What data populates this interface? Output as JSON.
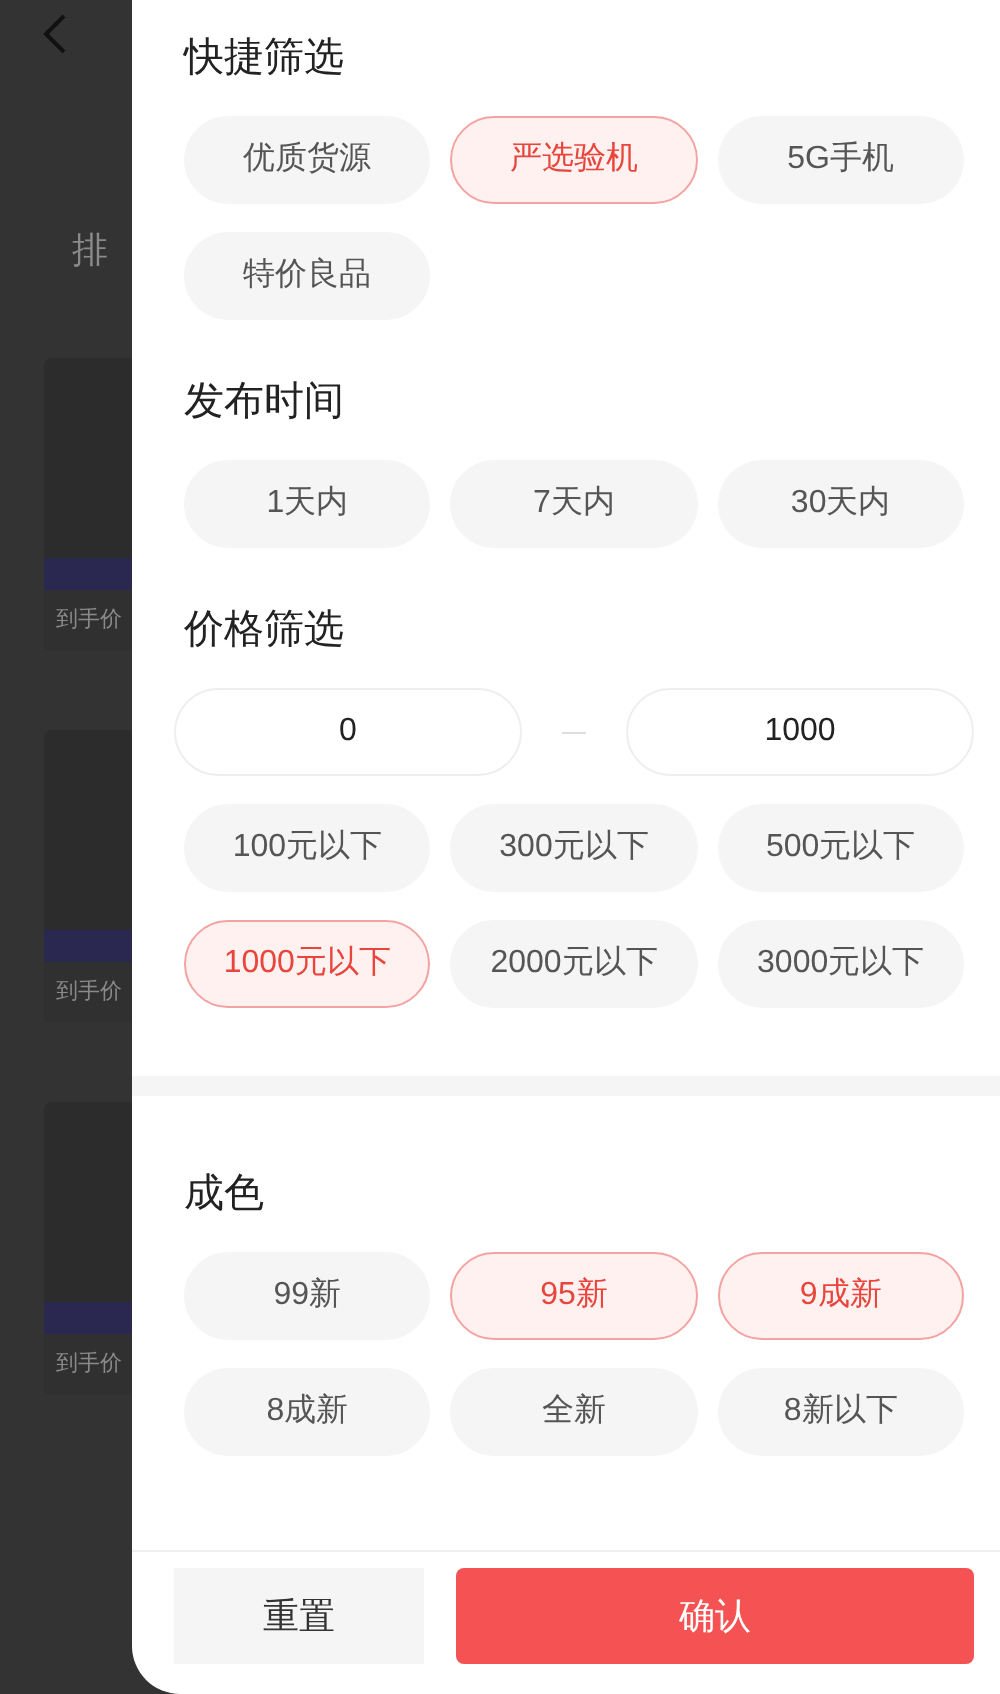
{
  "background": {
    "sort_label": "排",
    "price_labels": [
      "到手价",
      "到手价",
      "到手价"
    ]
  },
  "sections": [
    {
      "title": "快捷筛选",
      "options": [
        {
          "label": "优质货源",
          "selected": false
        },
        {
          "label": "严选验机",
          "selected": true
        },
        {
          "label": "5G手机",
          "selected": false
        },
        {
          "label": "特价良品",
          "selected": false
        }
      ]
    },
    {
      "title": "发布时间",
      "options": [
        {
          "label": "1天内",
          "selected": false
        },
        {
          "label": "7天内",
          "selected": false
        },
        {
          "label": "30天内",
          "selected": false
        }
      ]
    },
    {
      "title": "价格筛选",
      "price_min": "0",
      "price_max": "1000",
      "options": [
        {
          "label": "100元以下",
          "selected": false
        },
        {
          "label": "300元以下",
          "selected": false
        },
        {
          "label": "500元以下",
          "selected": false
        },
        {
          "label": "1000元以下",
          "selected": true
        },
        {
          "label": "2000元以下",
          "selected": false
        },
        {
          "label": "3000元以下",
          "selected": false
        }
      ]
    },
    {
      "title": "成色",
      "options": [
        {
          "label": "99新",
          "selected": false
        },
        {
          "label": "95新",
          "selected": true
        },
        {
          "label": "9成新",
          "selected": true
        },
        {
          "label": "8成新",
          "selected": false
        },
        {
          "label": "全新",
          "selected": false
        },
        {
          "label": "8新以下",
          "selected": false
        }
      ]
    }
  ],
  "buttons": {
    "reset": "重置",
    "confirm": "确认"
  }
}
